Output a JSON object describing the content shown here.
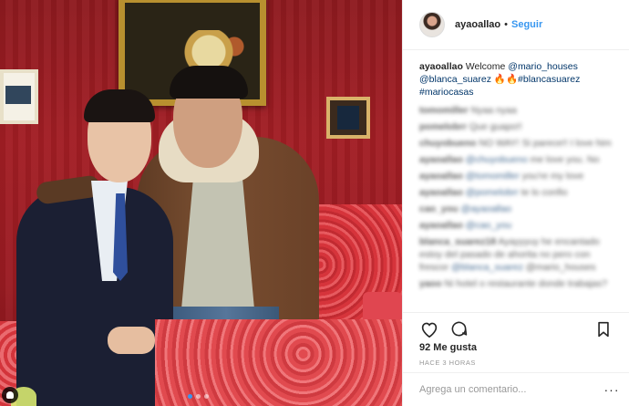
{
  "post": {
    "username": "ayaoallao",
    "follow_label": "Seguir",
    "separator": "•",
    "caption": {
      "username": "ayaoallao",
      "text_1": " Welcome ",
      "mention_1": "@mario_houses",
      "mention_2": "@blanca_suarez",
      "emoji": "🔥🔥",
      "hashtag_1": "#blancasuarez",
      "hashtag_2": "#mariocasas"
    },
    "likes": "92 Me gusta",
    "timestamp": "HACE 3 HORAS",
    "comment_placeholder": "Agrega un comentario...",
    "more_label": "···"
  },
  "comments": [
    {
      "user": "tomomiller",
      "text": " Nyaa nyaa"
    },
    {
      "user": "pomelobrr",
      "text": " Que guapo!!"
    },
    {
      "user": "chuyobueno",
      "text": " NO WAY! Si parece!! I love him"
    },
    {
      "user": "ayaoallao",
      "text": " ",
      "tag": "@chuyobueno",
      "text2": " me love you. No"
    },
    {
      "user": "ayaoallao",
      "text": " ",
      "tag": "@tomomiller",
      "text2": " you're my love"
    },
    {
      "user": "ayaoallao",
      "text": " ",
      "tag": "@pomelobrr",
      "text2": " te lo confio"
    },
    {
      "user": "cao_you",
      "text": " ",
      "tag": "@ayaoallao",
      "text2": ""
    },
    {
      "user": "ayaoallao",
      "text": " ",
      "tag": "@cao_you",
      "text2": ""
    },
    {
      "user": "blanca_suarez18",
      "text": " Ayayyyuy he encantado estoy del pasado de ahorita no pero con frescor ",
      "tag": "@blanca_suarez",
      "text2": " @mario_houses"
    },
    {
      "user": "yaoo",
      "text": " Ni hotel o restaurante donde trabajas?",
      "tag": "",
      "text2": ""
    }
  ],
  "icons": {
    "like": "heart-icon",
    "comment": "comment-icon",
    "save": "bookmark-icon",
    "user_tag": "user-tag-icon"
  },
  "colors": {
    "link": "#3897f0",
    "tag": "#003569",
    "text": "#262626",
    "muted": "#999999"
  }
}
